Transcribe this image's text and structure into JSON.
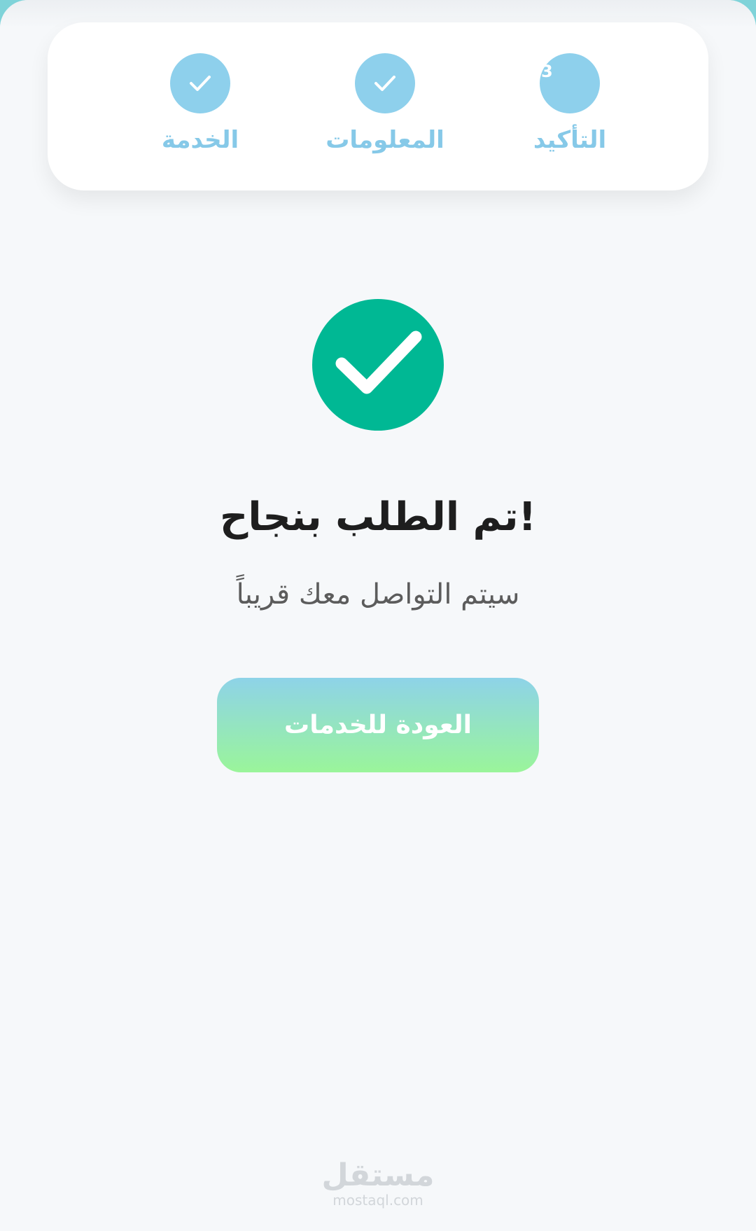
{
  "stepper": {
    "steps": [
      {
        "label": "الخدمة",
        "state": "completed",
        "icon": "check-icon"
      },
      {
        "label": "المعلومات",
        "state": "completed",
        "icon": "check-icon"
      },
      {
        "label": "التأكيد",
        "state": "current",
        "number": "3"
      }
    ]
  },
  "result": {
    "icon": "check-circle-icon",
    "title": "!تم الطلب بنجاح",
    "subtitle": "سيتم التواصل معك قريباً"
  },
  "actions": {
    "back_label": "العودة للخدمات"
  },
  "watermark": {
    "arabic": "مستقل",
    "latin": "mostaql.com"
  },
  "colors": {
    "step_accent": "#8ed0ec",
    "success": "#00b894",
    "button_top": "#8ed3e8",
    "button_bottom": "#9af59a"
  }
}
